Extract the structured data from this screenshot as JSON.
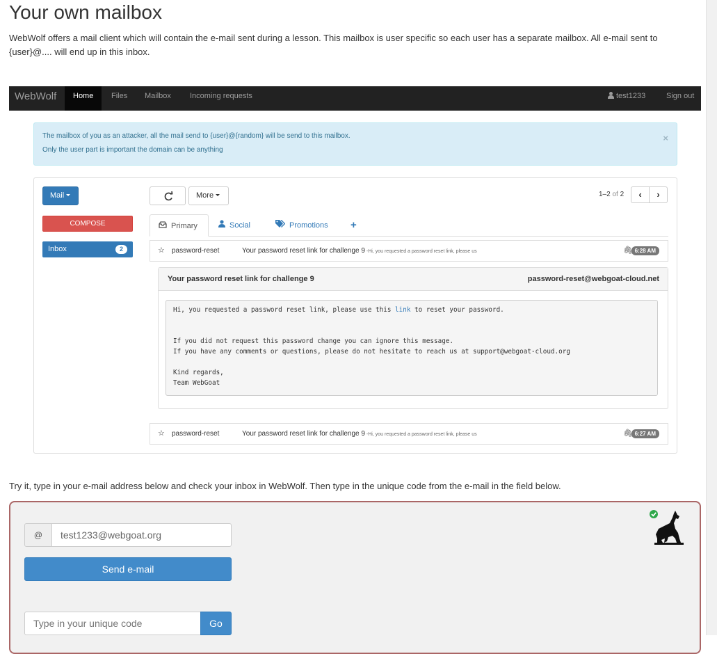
{
  "page": {
    "title": "Your own mailbox",
    "intro": "WebWolf offers a mail client which will contain the e-mail sent during a lesson. This mailbox is user specific so each user has a separate mailbox. All e-mail sent to {user}@.... will end up in this inbox.",
    "try_it": "Try it, type in your e-mail address below and check your inbox in WebWolf. Then type in the unique code from the e-mail in the field below."
  },
  "navbar": {
    "brand": "WebWolf",
    "items": [
      "Home",
      "Files",
      "Mailbox",
      "Incoming requests"
    ],
    "user": "test1233",
    "sign_out": "Sign out"
  },
  "alert": {
    "line1": "The mailbox of you as an attacker, all the mail send to {user}@{random} will be send to this mailbox.",
    "line2": "Only the user part is important the domain can be anything",
    "close": "×"
  },
  "mailbox": {
    "mail_button": "Mail",
    "compose": "COMPOSE",
    "inbox_label": "Inbox",
    "inbox_count": "2",
    "more_button": "More",
    "pager_range": "1–2",
    "pager_of": "of",
    "pager_total": "2",
    "tabs": {
      "primary": "Primary",
      "social": "Social",
      "promotions": "Promotions",
      "add": "+"
    },
    "emails": [
      {
        "from": "password-reset",
        "subject": "Your password reset link for challenge 9",
        "snippet": " -Hi, you requested a password reset link, please us",
        "time": "6:28 AM"
      },
      {
        "from": "password-reset",
        "subject": "Your password reset link for challenge 9",
        "snippet": " -Hi, you requested a password reset link, please us",
        "time": "6:27 AM"
      }
    ],
    "open_message": {
      "subject": "Your password reset link for challenge 9",
      "sender": "password-reset@webgoat-cloud.net",
      "line1_pre": "Hi, you requested a password reset link, please use this ",
      "line1_link": "link",
      "line1_post": " to reset your password.",
      "line2": "If you did not request this password change you can ignore this message.",
      "line3": "If you have any comments or questions, please do not hesitate to reach us at support@webgoat-cloud.org",
      "line4": "Kind regards,",
      "line5": "Team WebGoat"
    }
  },
  "form": {
    "at_symbol": "@",
    "email_value": "test1233@webgoat.org",
    "send_button": "Send e-mail",
    "code_placeholder": "Type in your unique code",
    "go_button": "Go"
  }
}
